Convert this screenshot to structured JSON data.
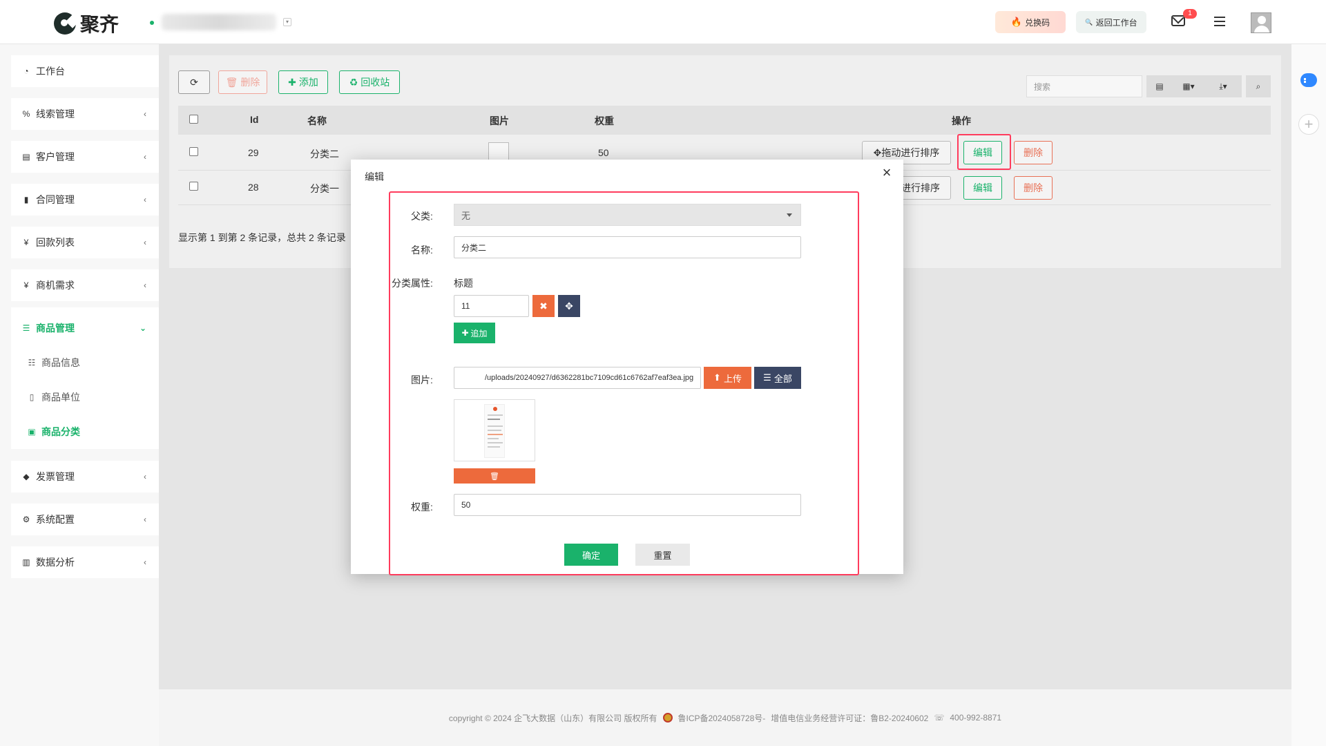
{
  "brand": {
    "name": "聚齐"
  },
  "header": {
    "exchange_label": "兑换码",
    "return_label": "返回工作台",
    "mail_badge": "1"
  },
  "sidebar": {
    "items": [
      {
        "label": "工作台",
        "icon": "dashboard-icon"
      },
      {
        "label": "线索管理",
        "icon": "link-icon"
      },
      {
        "label": "客户管理",
        "icon": "id-card-icon"
      },
      {
        "label": "合同管理",
        "icon": "bookmark-icon"
      },
      {
        "label": "回款列表",
        "icon": "yen-icon"
      },
      {
        "label": "商机需求",
        "icon": "yen-icon"
      },
      {
        "label": "商品管理",
        "icon": "list-icon"
      },
      {
        "label": "发票管理",
        "icon": "tag-icon"
      },
      {
        "label": "系统配置",
        "icon": "gears-icon"
      },
      {
        "label": "数据分析",
        "icon": "bar-chart-icon"
      }
    ],
    "sub_items": [
      {
        "label": "商品信息",
        "icon": "list-alt-icon"
      },
      {
        "label": "商品单位",
        "icon": "file-icon"
      },
      {
        "label": "商品分类",
        "icon": "calendar-icon"
      }
    ]
  },
  "toolbar": {
    "delete_label": "删除",
    "add_label": "添加",
    "recycle_label": "回收站",
    "search_placeholder": "搜索"
  },
  "table": {
    "columns": [
      "Id",
      "名称",
      "图片",
      "权重",
      "操作"
    ],
    "rows": [
      {
        "id": "29",
        "name": "分类二",
        "weight": "50"
      },
      {
        "id": "28",
        "name": "分类一",
        "weight": ""
      }
    ],
    "sort_label": "拖动进行排序",
    "sort_label_partial": "进行排序",
    "edit_label": "编辑",
    "delete_label": "删除",
    "pager_text": "显示第 1 到第 2 条记录，总共 2 条记录"
  },
  "modal": {
    "title": "编辑",
    "parent_label": "父类:",
    "parent_value": "无",
    "name_label": "名称:",
    "name_value": "分类二",
    "attr_label": "分类属性:",
    "attr_header": "标题",
    "attr_value": "11",
    "add_label": "追加",
    "image_label": "图片:",
    "image_path": "/uploads/20240927/d6362281bc7109cd61c6762af7eaf3ea.jpg",
    "upload_label": "上传",
    "all_label": "全部",
    "weight_label": "权重:",
    "weight_value": "50",
    "confirm_label": "确定",
    "reset_label": "重置"
  },
  "footer": {
    "copyright": "copyright © 2024 企飞大数据（山东）有限公司 版权所有",
    "icp": "鲁ICP备2024058728号-",
    "license": "增值电信业务经营许可证：鲁B2-20240602",
    "phone": "400-992-8871"
  },
  "colors": {
    "primary": "#1ab26b",
    "danger": "#e87055",
    "highlight": "#ff3b5c",
    "upload": "#ed6a3c",
    "navy": "#3a4664"
  }
}
